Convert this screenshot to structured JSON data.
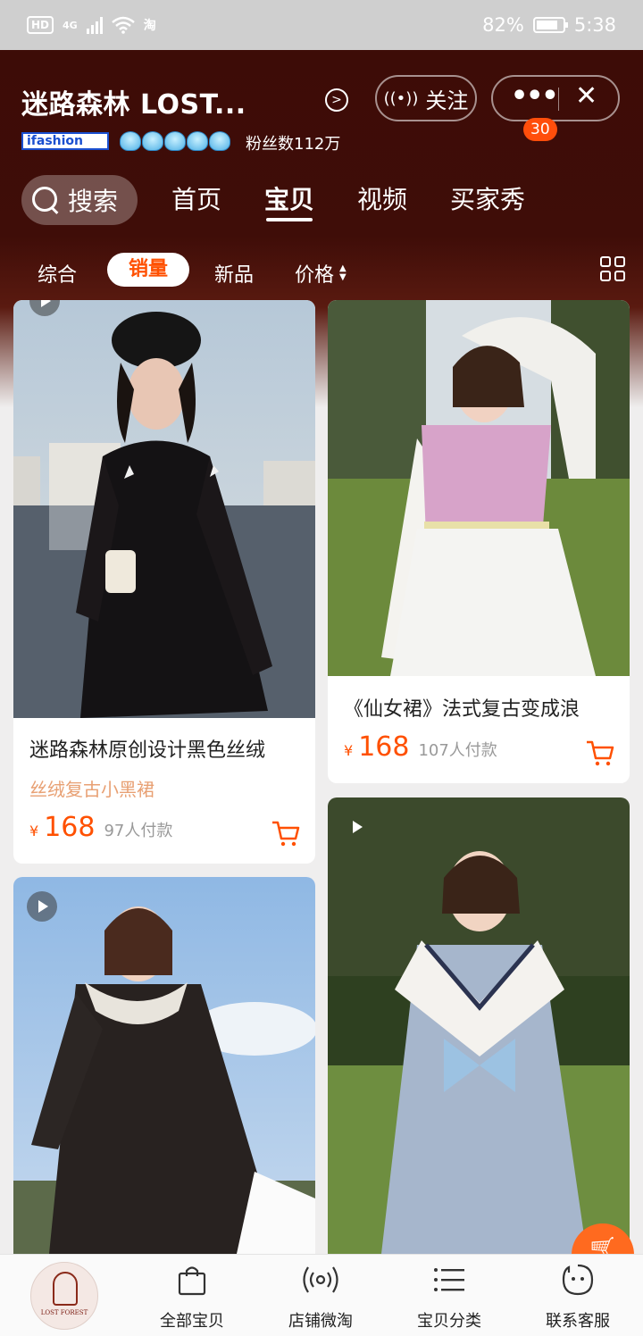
{
  "status_bar": {
    "hd": "HD",
    "network": "4G",
    "app": "淘",
    "battery": "82%",
    "battery_level": 0.82,
    "time": "5:38"
  },
  "header": {
    "shop_name": "迷路森林 LOST...",
    "follow_label": "关注",
    "badge_count": "30",
    "ifashion": "ifashion",
    "fans": "粉丝数112万"
  },
  "tabs": [
    {
      "label": "搜索"
    },
    {
      "label": "首页"
    },
    {
      "label": "宝贝",
      "active": true
    },
    {
      "label": "视频"
    },
    {
      "label": "买家秀"
    }
  ],
  "sort": {
    "all": "综合",
    "sales": "销量",
    "new": "新品",
    "price": "价格"
  },
  "products": [
    {
      "title": "迷路森林原创设计黑色丝绒",
      "subtitle": "丝绒复古小黑裙",
      "currency": "¥",
      "price": "168",
      "sold": "97人付款"
    },
    {
      "title": "《仙女裙》法式复古变成浪",
      "currency": "¥",
      "price": "168",
      "sold": "107人付款"
    }
  ],
  "bottom_bar": {
    "logo_text": "LOST FOREST",
    "items": [
      {
        "label": "全部宝贝"
      },
      {
        "label": "店铺微淘"
      },
      {
        "label": "宝贝分类"
      },
      {
        "label": "联系客服"
      }
    ]
  },
  "colors": {
    "accent": "#ff5000",
    "header_bg": "#3d0c07"
  }
}
